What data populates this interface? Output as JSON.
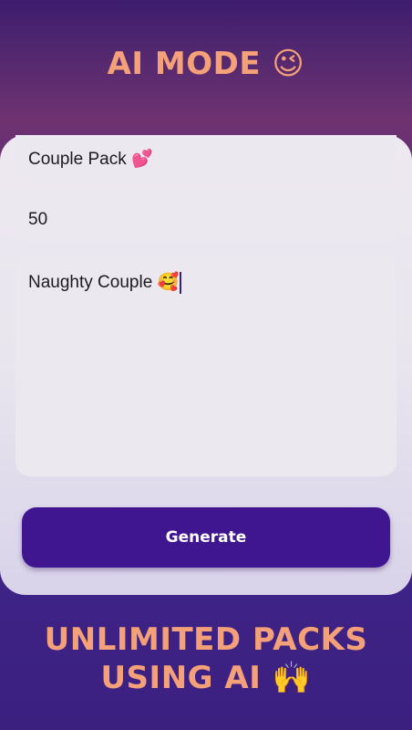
{
  "header": {
    "title": "AI MODE 😉"
  },
  "form": {
    "pack_name_value": "Couple Pack 💕",
    "count_value": "50",
    "prompt_value": "Naughty Couple 🥰"
  },
  "generate_button": {
    "label": "Generate"
  },
  "footer": {
    "line1": "UNLIMITED PACKS",
    "line2": "USING AI 🙌"
  },
  "colors": {
    "accent_text": "#f4a179",
    "button": "#3f168f",
    "background": "#3f2488"
  }
}
